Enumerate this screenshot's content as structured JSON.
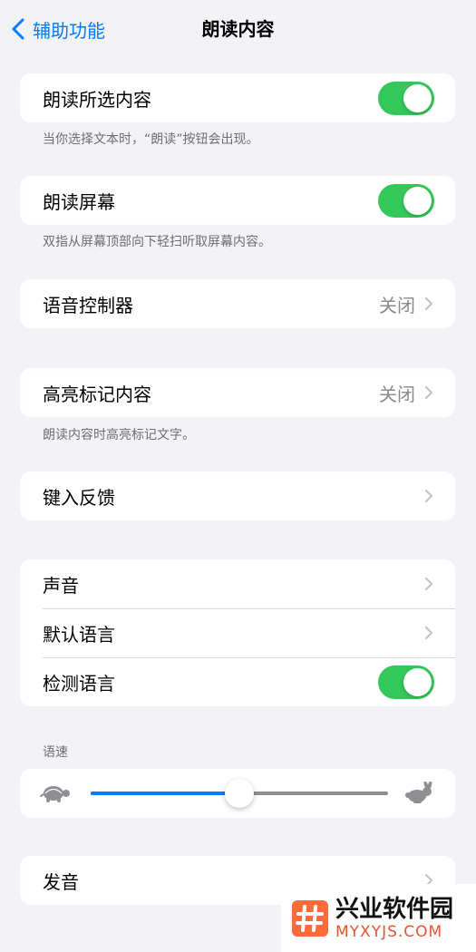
{
  "nav": {
    "back_label": "辅助功能",
    "title": "朗读内容"
  },
  "speak_selection": {
    "label": "朗读所选内容",
    "on": true,
    "footnote": "当你选择文本时，“朗读”按钮会出现。"
  },
  "speak_screen": {
    "label": "朗读屏幕",
    "on": true,
    "footnote": "双指从屏幕顶部向下轻扫听取屏幕内容。"
  },
  "speech_controller": {
    "label": "语音控制器",
    "value": "关闭"
  },
  "highlight_content": {
    "label": "高亮标记内容",
    "value": "关闭",
    "footnote": "朗读内容时高亮标记文字。"
  },
  "typing_feedback": {
    "label": "键入反馈"
  },
  "voice_group": {
    "voices_label": "声音",
    "default_language_label": "默认语言",
    "detect_language_label": "检测语言",
    "detect_language_on": true
  },
  "speaking_rate": {
    "header": "语速",
    "value_fraction": 0.5,
    "slow_icon": "turtle-icon",
    "fast_icon": "rabbit-icon"
  },
  "pronunciations": {
    "label": "发音"
  },
  "watermark": {
    "cn": "兴业软件园",
    "en": "MYXYJS.COM"
  },
  "colors": {
    "accent": "#007aff",
    "toggle_on": "#34c759",
    "background": "#f2f2f7"
  }
}
